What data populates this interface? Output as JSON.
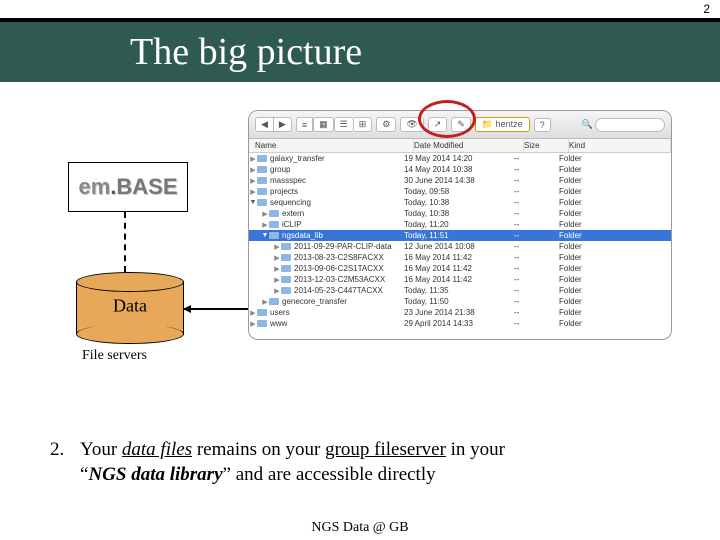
{
  "page_number": "2",
  "title": "The big picture",
  "embase": {
    "prefix": "em",
    "dot": ".",
    "suffix": "BASE"
  },
  "data_cyl_label": "Data",
  "file_servers_label": "File servers",
  "finder": {
    "folder_chip": "hentze",
    "search_icon": "🔍",
    "columns": {
      "name": "Name",
      "date": "Date Modified",
      "size": "Size",
      "kind": "Kind"
    },
    "rows": [
      {
        "tri": "▶",
        "indent": 0,
        "name": "galaxy_transfer",
        "date": "19 May 2014 14:20",
        "size": "--",
        "kind": "Folder",
        "sel": false,
        "open": false
      },
      {
        "tri": "▶",
        "indent": 0,
        "name": "group",
        "date": "14 May 2014 10:38",
        "size": "--",
        "kind": "Folder",
        "sel": false,
        "open": false
      },
      {
        "tri": "▶",
        "indent": 0,
        "name": "massspec",
        "date": "30 June 2014 14:38",
        "size": "--",
        "kind": "Folder",
        "sel": false,
        "open": false
      },
      {
        "tri": "▶",
        "indent": 0,
        "name": "projects",
        "date": "Today, 09:58",
        "size": "--",
        "kind": "Folder",
        "sel": false,
        "open": false
      },
      {
        "tri": "▼",
        "indent": 0,
        "name": "sequencing",
        "date": "Today, 10:38",
        "size": "--",
        "kind": "Folder",
        "sel": false,
        "open": true
      },
      {
        "tri": "▶",
        "indent": 1,
        "name": "extern",
        "date": "Today, 10:38",
        "size": "--",
        "kind": "Folder",
        "sel": false,
        "open": false
      },
      {
        "tri": "▶",
        "indent": 1,
        "name": "iCLIP",
        "date": "Today, 11:20",
        "size": "--",
        "kind": "Folder",
        "sel": false,
        "open": false
      },
      {
        "tri": "▼",
        "indent": 1,
        "name": "ngsdata_lib",
        "date": "Today, 11:51",
        "size": "--",
        "kind": "Folder",
        "sel": true,
        "open": true
      },
      {
        "tri": "▶",
        "indent": 2,
        "name": "2011-09-29-PAR-CLIP-data",
        "date": "12 June 2014 10:08",
        "size": "--",
        "kind": "Folder",
        "sel": false,
        "open": false
      },
      {
        "tri": "▶",
        "indent": 2,
        "name": "2013-08-23-C2S8FACXX",
        "date": "16 May 2014 11:42",
        "size": "--",
        "kind": "Folder",
        "sel": false,
        "open": false
      },
      {
        "tri": "▶",
        "indent": 2,
        "name": "2013-09-06-C2S1TACXX",
        "date": "16 May 2014 11:42",
        "size": "--",
        "kind": "Folder",
        "sel": false,
        "open": false
      },
      {
        "tri": "▶",
        "indent": 2,
        "name": "2013-12-03-C2M53ACXX",
        "date": "16 May 2014 11:42",
        "size": "--",
        "kind": "Folder",
        "sel": false,
        "open": false
      },
      {
        "tri": "▶",
        "indent": 2,
        "name": "2014-05-23-C447TACXX",
        "date": "Today, 11:35",
        "size": "--",
        "kind": "Folder",
        "sel": false,
        "open": false
      },
      {
        "tri": "▶",
        "indent": 1,
        "name": "genecore_transfer",
        "date": "Today, 11:50",
        "size": "--",
        "kind": "Folder",
        "sel": false,
        "open": false
      },
      {
        "tri": "▶",
        "indent": 0,
        "name": "users",
        "date": "23 June 2014 21:38",
        "size": "--",
        "kind": "Folder",
        "sel": false,
        "open": false
      },
      {
        "tri": "▶",
        "indent": 0,
        "name": "www",
        "date": "29 April 2014 14:33",
        "size": "--",
        "kind": "Folder",
        "sel": false,
        "open": false
      }
    ]
  },
  "body": {
    "num": "2.",
    "line1_a": "Your ",
    "line1_b": "data files",
    "line1_c": " remains on your ",
    "line1_d": "group fileserver",
    "line1_e": " in your ",
    "line2_a": "“",
    "line2_b": "NGS data library",
    "line2_c": "” and are accessible directly"
  },
  "footer": "NGS Data @ GB",
  "toolbar": {
    "back": "◀",
    "fwd": "▶",
    "v1": "≡",
    "v2": "▦",
    "v3": "☰",
    "v4": "⊞",
    "cog": "⚙",
    "eye": "👁",
    "share": "↗",
    "tag": "✎",
    "q": "?"
  }
}
